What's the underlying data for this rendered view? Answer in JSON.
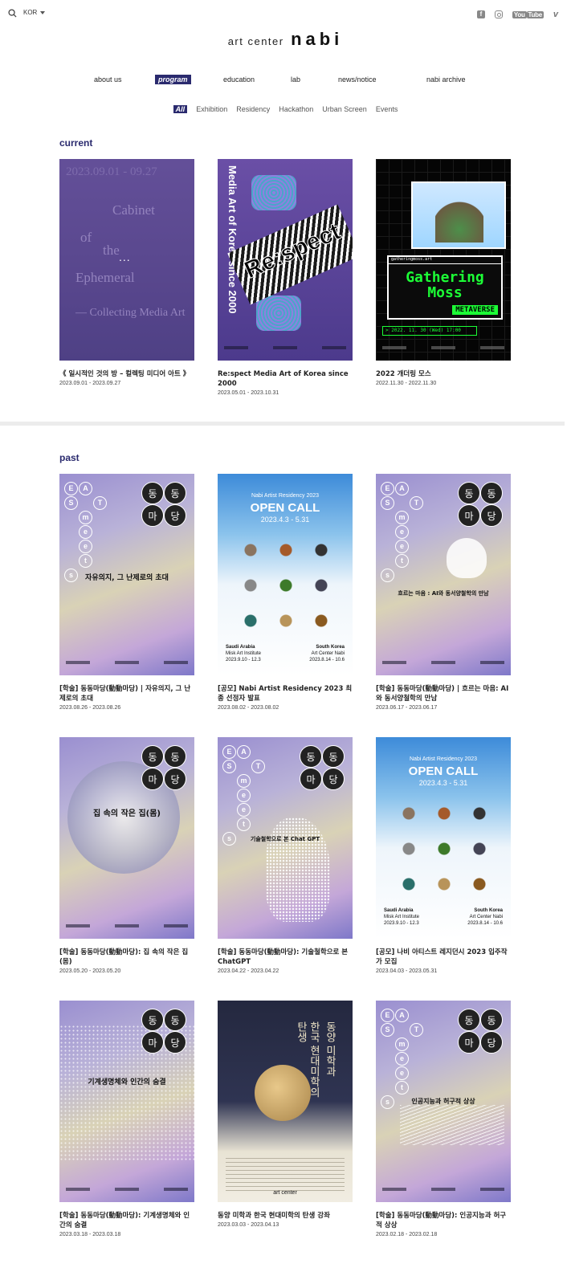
{
  "header": {
    "lang": "KOR",
    "logo_small": "art center",
    "logo_big": "nabi",
    "social": [
      "facebook-icon",
      "instagram-icon",
      "youtube-icon",
      "vimeo-icon"
    ],
    "youtube_label": "You",
    "youtube_label2": "Tube",
    "vimeo_label": "v"
  },
  "nav": [
    {
      "label": "about us"
    },
    {
      "label": "program",
      "active": true
    },
    {
      "label": "education"
    },
    {
      "label": "lab"
    },
    {
      "label": "news/notice"
    },
    {
      "label": "nabi archive"
    }
  ],
  "filters": [
    "All",
    "Exhibition",
    "Residency",
    "Hackathon",
    "Urban Screen",
    "Events"
  ],
  "current": {
    "heading": "current",
    "items": [
      {
        "title": "《 일시적인 것의 방 – 컬렉팅 미디어 아트 》",
        "date": "2023.09.01 - 2023.09.27"
      },
      {
        "title": "Re:spect Media Art of Korea since 2000",
        "date": "2023.05.01 - 2023.10.31"
      },
      {
        "title": "2022 개더링 모스",
        "date": "2022.11.30 - 2022.11.30"
      }
    ]
  },
  "past": {
    "heading": "past",
    "items": [
      {
        "title": "[학술] 동동마당(動動마당) | 자유의지, 그 난제로의 초대",
        "date": "2023.08.26 - 2023.08.26"
      },
      {
        "title": "[공모] Nabi Artist Residency 2023 최종 선정자 발표",
        "date": "2023.08.02 - 2023.08.02"
      },
      {
        "title": "[학술] 동동마당(動動마당) | 흐르는 마음: AI와 동서양철학의 만남",
        "date": "2023.06.17 - 2023.06.17"
      },
      {
        "title": "[학술] 동동마당(動動마당): 집 속의 작은 집(몸)",
        "date": "2023.05.20 - 2023.05.20"
      },
      {
        "title": "[학술] 동동마당(動動마당): 기술철학으로 본 ChatGPT",
        "date": "2023.04.22 - 2023.04.22"
      },
      {
        "title": "[공모] 나비 아티스트 레지던시 2023 입주작가 모집",
        "date": "2023.04.03 - 2023.05.31"
      },
      {
        "title": "[학술] 동동마당(動動마당): 기계생명체와 인간의 숨결",
        "date": "2023.03.18 - 2023.03.18"
      },
      {
        "title": "동양 미학과 한국 현대미학의 탄생 강좌",
        "date": "2023.03.03 - 2023.04.13"
      },
      {
        "title": "[학술] 동동마당(動動마당): 인공지능과 허구적 상상",
        "date": "2023.02.18 - 2023.02.18"
      }
    ]
  },
  "posters": {
    "cabinet": {
      "dates": "2023.09.01 - 09.27",
      "l1": "Cabinet",
      "l2": "of",
      "l3": "the",
      "l4": "Ephemeral",
      "l5": "— Collecting Media Art",
      "overlay": "..."
    },
    "respect": {
      "vertical": "Media Art of Korea since 2000",
      "title": "Re:spect"
    },
    "gather": {
      "url": "gatheringmoss.art",
      "t1": "Gathering",
      "t2": "Moss",
      "t3": "METAVERSE",
      "when": "> 2022. 11. 30 (Wed) 17:00"
    },
    "eams_letters": [
      "E",
      "A",
      "S",
      "T",
      "m",
      "e",
      "e",
      "t",
      "s"
    ],
    "ddm": [
      "동",
      "동",
      "마",
      "당"
    ],
    "p1_text": "자유의지, 그 난제로의 초대",
    "open": {
      "small": "Nabi Artist Residency 2023",
      "big": "OPEN CALL",
      "dates": "2023.4.3 - 5.31",
      "left": "Saudi Arabia",
      "left2": "Misk Art Institute",
      "left3": "2023.9.10 - 12.3",
      "right": "South Korea",
      "right2": "Art Center Nabi",
      "right3": "2023.8.14 - 10.6"
    },
    "p3_text": "흐르는 마음 : AI와 동서양철학의 만남",
    "p4_text": "집 속의 작은 집(몸)",
    "p5_text": "기술철학으로 본 Chat GPT",
    "p7_text": "기계생명체와 인간의 숨결",
    "dark": {
      "v1": "탄생",
      "v2": "한국 현대미학의",
      "v3": "동양 미학과"
    },
    "p9_text": "인공지능과 허구적 상상"
  }
}
